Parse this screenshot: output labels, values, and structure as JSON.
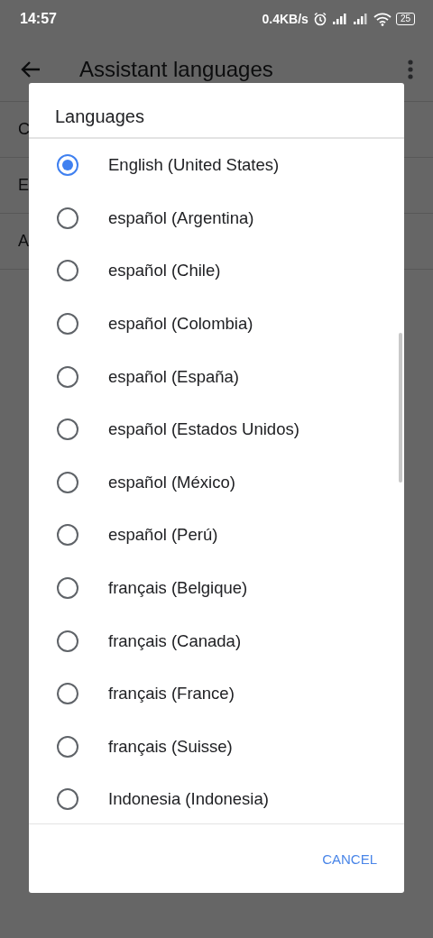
{
  "status_bar": {
    "time": "14:57",
    "speed": "0.4KB/s",
    "battery": "25"
  },
  "app_bar": {
    "title": "Assistant languages"
  },
  "background_rows": [
    {
      "label": "C"
    },
    {
      "label": "E"
    },
    {
      "label": "A"
    }
  ],
  "dialog": {
    "title": "Languages",
    "options": [
      {
        "label": "English (United States)",
        "selected": true
      },
      {
        "label": "español (Argentina)",
        "selected": false
      },
      {
        "label": "español (Chile)",
        "selected": false
      },
      {
        "label": "español (Colombia)",
        "selected": false
      },
      {
        "label": "español (España)",
        "selected": false
      },
      {
        "label": "español (Estados Unidos)",
        "selected": false
      },
      {
        "label": "español (México)",
        "selected": false
      },
      {
        "label": "español (Perú)",
        "selected": false
      },
      {
        "label": "français (Belgique)",
        "selected": false
      },
      {
        "label": "français (Canada)",
        "selected": false
      },
      {
        "label": "français (France)",
        "selected": false
      },
      {
        "label": "français (Suisse)",
        "selected": false
      },
      {
        "label": "Indonesia (Indonesia)",
        "selected": false
      }
    ],
    "buttons": [
      "CANCEL"
    ]
  }
}
